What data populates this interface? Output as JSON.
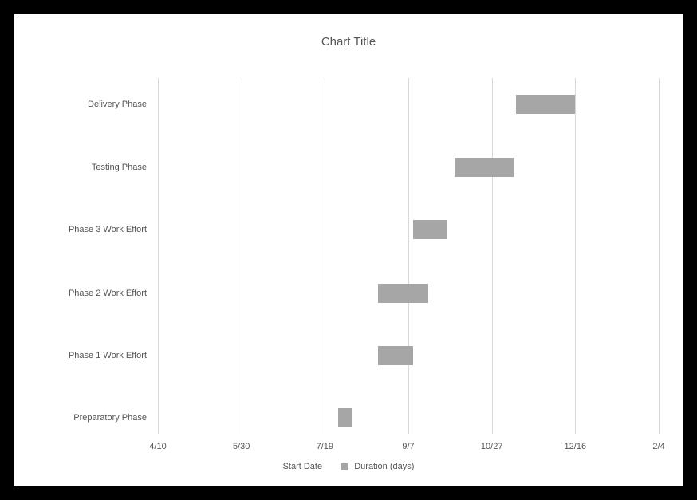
{
  "chart_data": {
    "type": "bar",
    "title": "Chart Title",
    "orientation": "horizontal-gantt",
    "categories": [
      "Delivery Phase",
      "Testing Phase",
      "Phase 3 Work Effort",
      "Phase 2 Work Effort",
      "Phase 1 Work Effort",
      "Preparatory Phase"
    ],
    "x_axis": {
      "type": "date",
      "ticks": [
        "4/10",
        "5/30",
        "7/19",
        "9/7",
        "10/27",
        "12/16",
        "2/4"
      ],
      "tick_positions_pct": [
        0,
        16.67,
        33.33,
        50,
        66.67,
        83.33,
        100
      ]
    },
    "series": [
      {
        "name": "Start Date",
        "role": "offset",
        "values": [
          "11/10",
          "10/5",
          "9/10",
          "8/20",
          "8/20",
          "7/27"
        ]
      },
      {
        "name": "Duration (days)",
        "role": "length",
        "values": [
          35,
          35,
          20,
          30,
          20,
          8
        ]
      }
    ],
    "bars": [
      {
        "category": "Delivery Phase",
        "start_pct": 71.5,
        "width_pct": 11.8
      },
      {
        "category": "Testing Phase",
        "start_pct": 59.3,
        "width_pct": 11.8
      },
      {
        "category": "Phase 3 Work Effort",
        "start_pct": 51.0,
        "width_pct": 6.7
      },
      {
        "category": "Phase 2 Work Effort",
        "start_pct": 44.0,
        "width_pct": 10.0
      },
      {
        "category": "Phase 1 Work Effort",
        "start_pct": 44.0,
        "width_pct": 6.9
      },
      {
        "category": "Preparatory Phase",
        "start_pct": 36.0,
        "width_pct": 2.7
      }
    ],
    "row_center_pct": [
      7.5,
      25,
      42.5,
      60.5,
      78,
      95.5
    ],
    "legend": [
      "Start Date",
      "Duration (days)"
    ]
  }
}
